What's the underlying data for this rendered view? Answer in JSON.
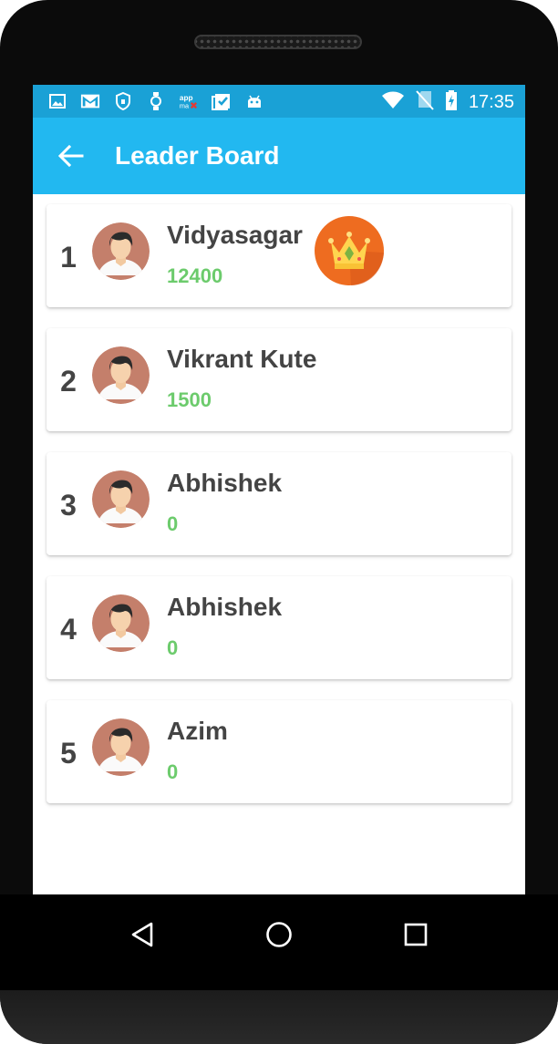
{
  "status_bar": {
    "time": "17:35",
    "left_icons": [
      "gallery-icon",
      "gmail-icon",
      "vpn-shield-icon",
      "watch-icon",
      "appmax-icon",
      "clipboard-icon",
      "android-icon"
    ],
    "right_icons": [
      "wifi-icon",
      "no-sim-icon",
      "battery-charging-icon"
    ]
  },
  "app_bar": {
    "title": "Leader Board",
    "back_icon": "arrow-left-icon"
  },
  "leaderboard": [
    {
      "rank": "1",
      "name": "Vidyasagar",
      "score": "12400",
      "badge": "crown-icon"
    },
    {
      "rank": "2",
      "name": "Vikrant Kute",
      "score": "1500"
    },
    {
      "rank": "3",
      "name": "Abhishek",
      "score": "0"
    },
    {
      "rank": "4",
      "name": "Abhishek",
      "score": "0"
    },
    {
      "rank": "5",
      "name": "Azim",
      "score": "0"
    }
  ],
  "colors": {
    "status_bar": "#1aa1d6",
    "app_bar": "#22b8f0",
    "score": "#6ccb6c",
    "text": "#444444",
    "crown_badge": "#ee6c20"
  },
  "nav_bar": [
    "back-triangle-icon",
    "home-circle-icon",
    "recents-square-icon"
  ]
}
